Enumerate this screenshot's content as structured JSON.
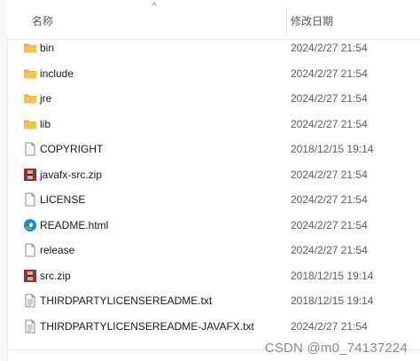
{
  "header": {
    "name_column": "名称",
    "date_column": "修改日期",
    "sort_indicator": "^"
  },
  "files": [
    {
      "name": "bin",
      "date": "2024/2/27 21:54",
      "icon": "folder-icon"
    },
    {
      "name": "include",
      "date": "2024/2/27 21:54",
      "icon": "folder-icon"
    },
    {
      "name": "jre",
      "date": "2024/2/27 21:54",
      "icon": "folder-icon"
    },
    {
      "name": "lib",
      "date": "2024/2/27 21:54",
      "icon": "folder-icon"
    },
    {
      "name": "COPYRIGHT",
      "date": "2018/12/15 19:14",
      "icon": "file-icon"
    },
    {
      "name": "javafx-src.zip",
      "date": "2024/2/27 21:54",
      "icon": "zip-archive-icon"
    },
    {
      "name": "LICENSE",
      "date": "2024/2/27 21:54",
      "icon": "file-icon"
    },
    {
      "name": "README.html",
      "date": "2024/2/27 21:54",
      "icon": "edge-browser-icon"
    },
    {
      "name": "release",
      "date": "2024/2/27 21:54",
      "icon": "file-icon"
    },
    {
      "name": "src.zip",
      "date": "2018/12/15 19:14",
      "icon": "zip-archive-icon"
    },
    {
      "name": "THIRDPARTYLICENSEREADME.txt",
      "date": "2018/12/15 19:14",
      "icon": "text-file-icon"
    },
    {
      "name": "THIRDPARTYLICENSEREADME-JAVAFX.txt",
      "date": "2024/2/27 21:54",
      "icon": "text-file-icon"
    }
  ],
  "watermark": "CSDN @m0_74137224",
  "colors": {
    "folder": "#f5c34b",
    "folder_dark": "#e0a92c",
    "zip_red": "#b3262d",
    "zip_purple": "#5a3b8c",
    "edge_blue": "#1e88d8",
    "edge_green": "#3fbf6f"
  }
}
